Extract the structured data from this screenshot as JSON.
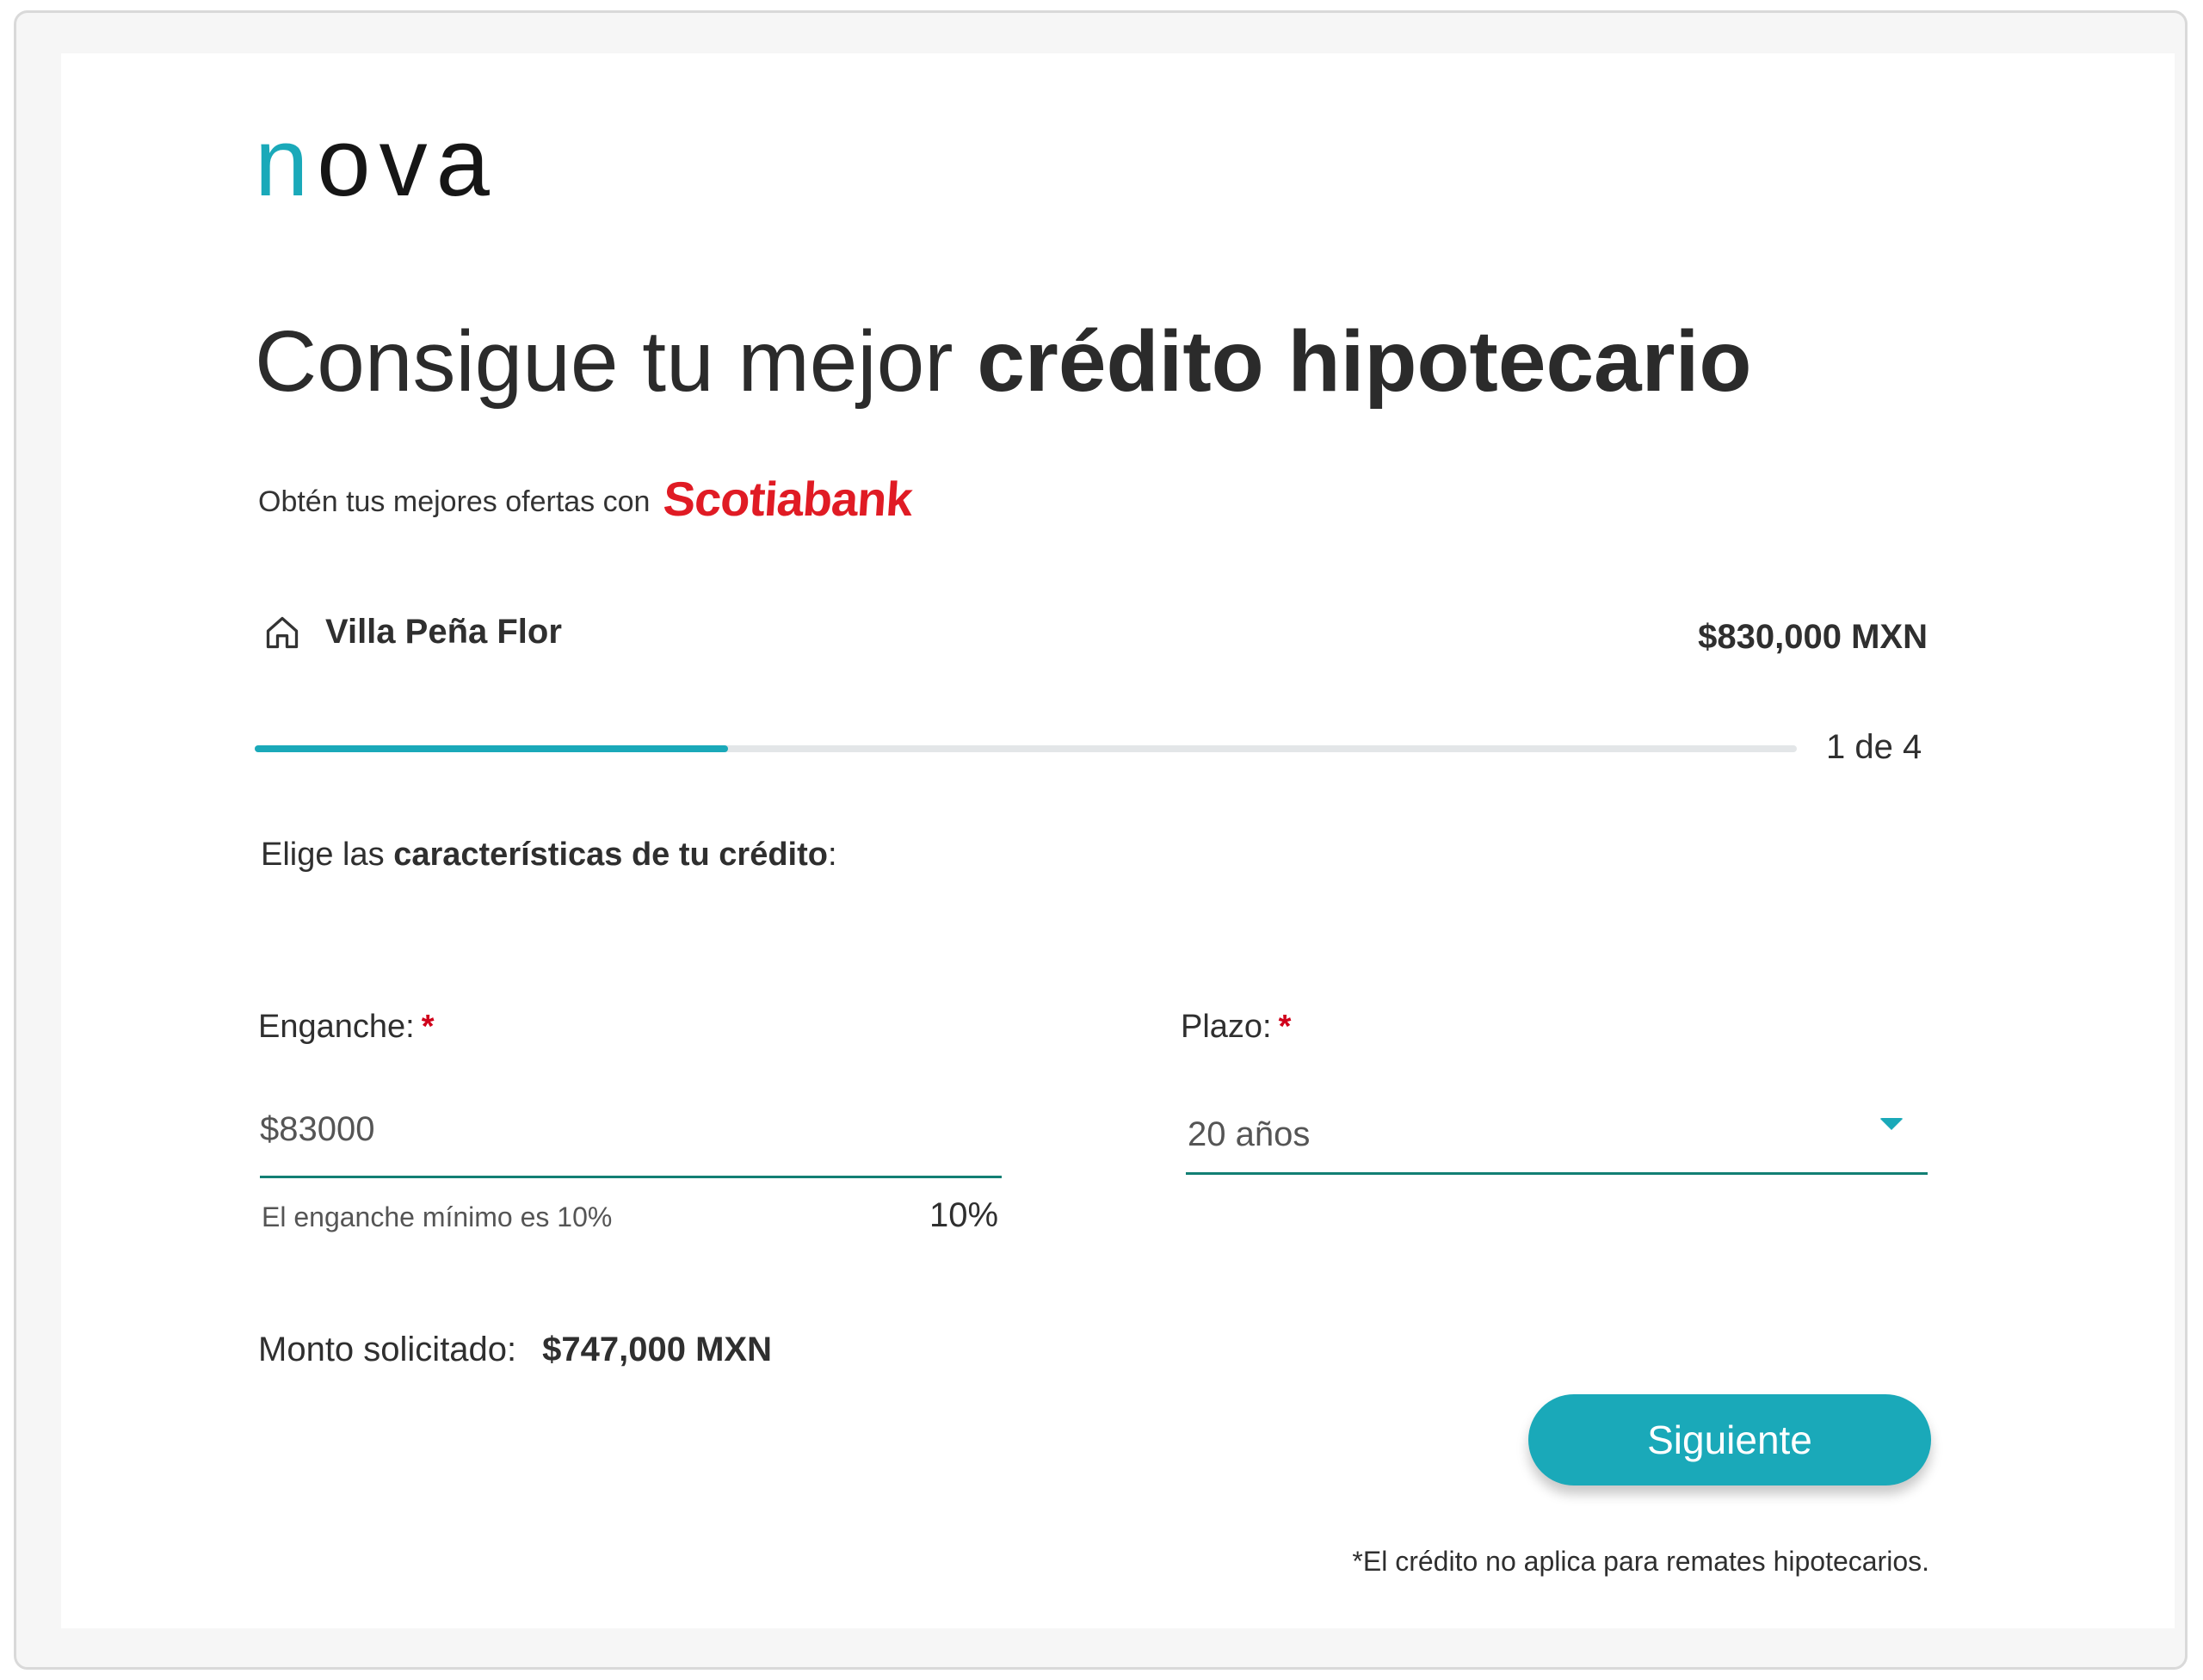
{
  "brand": {
    "logo_first": "n",
    "logo_rest": "ova",
    "accent_color": "#1aa9b9",
    "partner": "Scotiabank",
    "partner_color": "#e01b24"
  },
  "header": {
    "title_regular": "Consigue tu mejor ",
    "title_bold": "crédito hipotecario",
    "subtitle": "Obtén tus mejores ofertas con"
  },
  "property": {
    "icon": "house-icon",
    "name": "Villa Peña Flor",
    "price": "$830,000 MXN"
  },
  "progress": {
    "current_step": 1,
    "total_steps": 4,
    "fraction": 0.307,
    "label": "1 de 4"
  },
  "form": {
    "prompt_regular": "Elige las ",
    "prompt_bold": "características de tu crédito",
    "prompt_suffix": ":",
    "required_mark": "*",
    "enganche": {
      "label": "Enganche:",
      "value": "$83000",
      "hint": "El enganche mínimo es 10%",
      "percent": "10%"
    },
    "plazo": {
      "label": "Plazo:",
      "selected": "20 años",
      "icon": "caret-down-icon"
    },
    "monto": {
      "label": "Monto solicitado:",
      "value": "$747,000 MXN"
    },
    "next_label": "Siguiente",
    "footnote": "*El crédito no aplica para remates hipotecarios."
  }
}
